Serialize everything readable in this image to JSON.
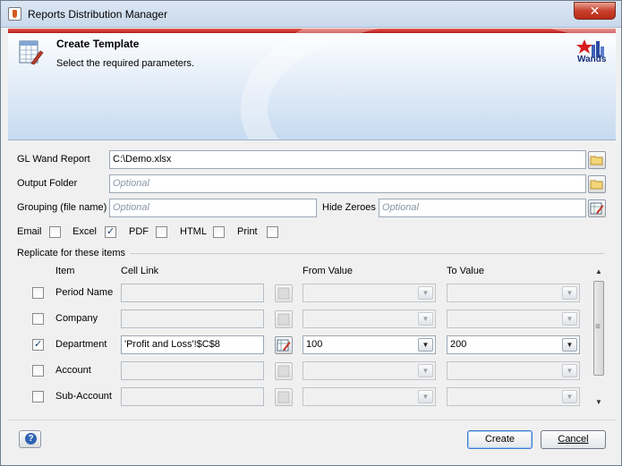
{
  "window": {
    "title": "Reports Distribution Manager",
    "close_glyph": "✕"
  },
  "banner": {
    "title": "Create Template",
    "subtitle": "Select the required parameters.",
    "brand": "Wands",
    "icon": "template-icon"
  },
  "form": {
    "gl_wand_report_label": "GL Wand Report",
    "gl_wand_report_value": "C:\\Demo.xlsx",
    "output_folder_label": "Output Folder",
    "output_folder_placeholder": "Optional",
    "grouping_label": "Grouping (file name)",
    "grouping_placeholder": "Optional",
    "hide_zeroes_label": "Hide Zeroes",
    "hide_zeroes_placeholder": "Optional"
  },
  "formats": [
    {
      "label": "Email",
      "checked": false
    },
    {
      "label": "Excel",
      "checked": true
    },
    {
      "label": "PDF",
      "checked": false
    },
    {
      "label": "HTML",
      "checked": false
    },
    {
      "label": "Print",
      "checked": false
    }
  ],
  "replicate": {
    "title": "Replicate for these items",
    "columns": {
      "item": "Item",
      "cell_link": "Cell Link",
      "from_value": "From Value",
      "to_value": "To Value"
    },
    "rows": [
      {
        "checked": false,
        "item": "Period Name",
        "cell_link": "",
        "from_value": "",
        "to_value": ""
      },
      {
        "checked": false,
        "item": "Company",
        "cell_link": "",
        "from_value": "",
        "to_value": ""
      },
      {
        "checked": true,
        "item": "Department",
        "cell_link": "'Profit and Loss'!$C$8",
        "from_value": "100",
        "to_value": "200"
      },
      {
        "checked": false,
        "item": "Account",
        "cell_link": "",
        "from_value": "",
        "to_value": ""
      },
      {
        "checked": false,
        "item": "Sub-Account",
        "cell_link": "",
        "from_value": "",
        "to_value": ""
      }
    ]
  },
  "buttons": {
    "create": "Create",
    "cancel": "Cancel"
  },
  "colors": {
    "accent_red": "#b0181d",
    "banner_blue": "#c7daf0",
    "focus_blue": "#3d7bd0"
  }
}
